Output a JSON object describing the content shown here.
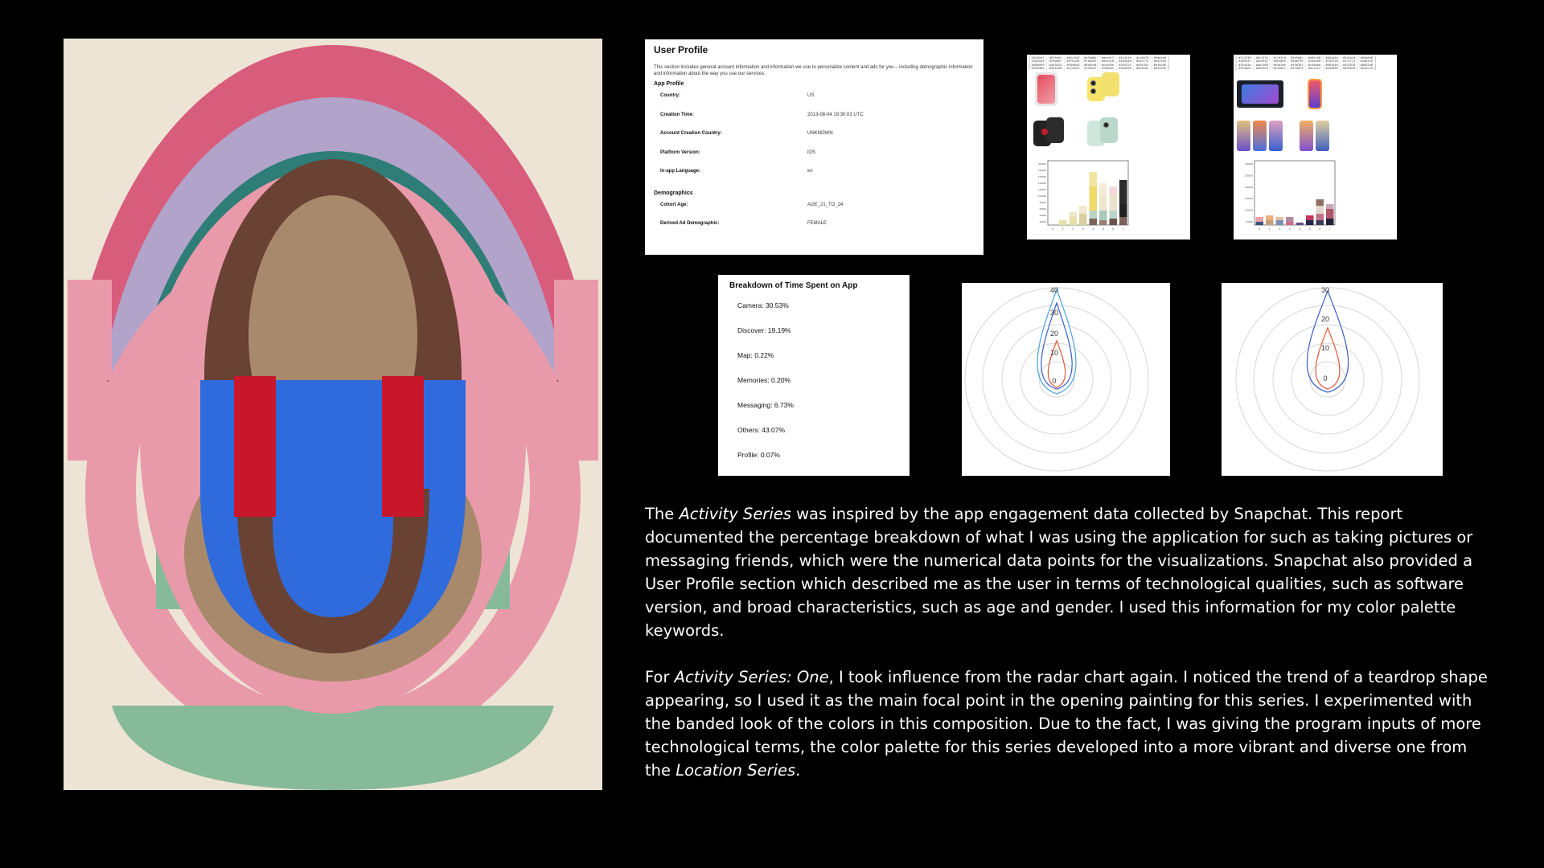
{
  "profile": {
    "title": "User Profile",
    "description": "This section includes general account information and information we use to personalize content and ads for you – including demographic information and information about the way you use our services.",
    "app_profile_label": "App Profile",
    "app_rows": [
      {
        "key": "Country:",
        "value": "US"
      },
      {
        "key": "Creation Time:",
        "value": "2013-08-04 19:30:03 UTC"
      },
      {
        "key": "Account Creation Country:",
        "value": "UNKNOWN"
      },
      {
        "key": "Platform Version:",
        "value": "iOS"
      },
      {
        "key": "In-app Language:",
        "value": "en"
      }
    ],
    "demographics_label": "Demographics",
    "demo_rows": [
      {
        "key": "Cohort Age:",
        "value": "AGE_21_TO_24"
      },
      {
        "key": "Derived Ad Demographic:",
        "value": "FEMALE"
      }
    ]
  },
  "breakdown": {
    "title": "Breakdown of Time Spent on App",
    "items": [
      "Camera: 30.53%",
      "Discover: 19.19%",
      "Map: 0.22%",
      "Memories: 0.20%",
      "Messaging: 6.73%",
      "Others: 43.07%",
      "Profile: 0.07%"
    ]
  },
  "radar_left": {
    "tick_labels": [
      "40",
      "30",
      "20",
      "10",
      "0"
    ],
    "colors": [
      "#4aa0dc",
      "#3a5fc8",
      "#e0553a"
    ]
  },
  "radar_right": {
    "tick_labels": [
      "30",
      "20",
      "10",
      "0"
    ],
    "colors": [
      "#3a5fc8",
      "#e0553a"
    ]
  },
  "sheet_left_chart": {
    "type": "bar",
    "categories": [
      "0",
      "1",
      "2",
      "3",
      "4",
      "5",
      "6",
      "7"
    ],
    "y_ticks": [
      "200000",
      "180000",
      "160000",
      "140000",
      "120000",
      "100000",
      "80000",
      "60000",
      "40000",
      "20000"
    ]
  },
  "sheet_right_chart": {
    "type": "bar",
    "categories": [
      "0",
      "1",
      "2",
      "3",
      "4",
      "5",
      "6",
      "7"
    ],
    "y_ticks": [
      "300000",
      "250000",
      "200000",
      "150000",
      "100000",
      "50000"
    ]
  },
  "caption": {
    "p1_before": "The ",
    "p1_italic": "Activity Series",
    "p1_after": " was inspired by the app engagement data collected by Snapchat. This report documented the percentage breakdown of what I was using the application for such as taking pictures or messaging friends, which were the numerical data points for the visualizations. Snapchat also provided a User Profile section which described me as the user in terms of technological qualities, such as software version, and broad characteristics, such as age and gender. I used this information for my color palette keywords.",
    "p2_before": "For ",
    "p2_italic": "Activity Series: One",
    "p2_middle": ", I took influence from the radar chart again. I noticed the trend of a teardrop shape appearing, so I used it as the main focal point in the opening painting for this series. I experimented with the banded look of the colors in this composition. Due to the fact, I was giving the program inputs of more technological terms, the color palette for this series developed into a more vibrant and diverse one from the ",
    "p2_italic2": "Location Series",
    "p2_after": "."
  },
  "palette": {
    "background": "#000000",
    "canvas": "#ede4d6",
    "pink_dark": "#d85c7c",
    "lilac": "#b1a3c9",
    "teal": "#2e7d76",
    "pink_light": "#e99aaa",
    "brown_dark": "#6a4234",
    "tan": "#a8896c",
    "blue": "#2f6bdc",
    "red": "#c8162a",
    "green": "#87ba98",
    "black_band": "#1c1c1c"
  }
}
